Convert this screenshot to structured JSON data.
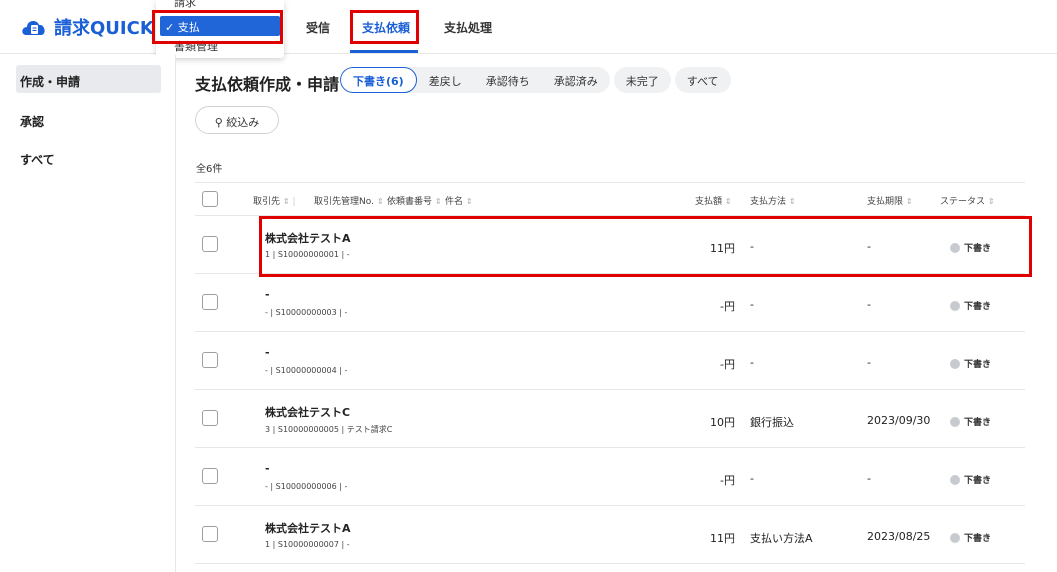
{
  "app": {
    "logo_text": "請求QUICK",
    "logo_alt": "QUICK"
  },
  "mode_menu": {
    "option_above": "請求",
    "selected": "✓ 支払",
    "option_below": "書類管理"
  },
  "nav_tabs": [
    {
      "label": "受信"
    },
    {
      "label": "支払依頼"
    },
    {
      "label": "支払処理"
    }
  ],
  "sidebar": {
    "items": [
      {
        "label": "作成・申請"
      },
      {
        "label": "承認"
      },
      {
        "label": "すべて"
      }
    ]
  },
  "page": {
    "title": "支払依頼作成・申請",
    "filter_button": "⚲ 絞込み",
    "count": "全6件"
  },
  "filter_tabs": {
    "group": [
      "下書き(6)",
      "差戻し",
      "承認待ち",
      "承認済み"
    ],
    "solo": [
      "未完了",
      "すべて"
    ]
  },
  "table": {
    "headers": {
      "vendor": "取引先",
      "vendor_no": "取引先管理No.",
      "doc_no": "依頼書番号",
      "subject": "件名",
      "amount": "支払額",
      "method": "支払方法",
      "due": "支払期限",
      "status": "ステータス"
    },
    "rows": [
      {
        "name": "株式会社テストA",
        "sub": "1 | S10000000001 | -",
        "amount": "11円",
        "method": "-",
        "due": "-",
        "status": "下書き"
      },
      {
        "name": "-",
        "sub": "- | S10000000003 | -",
        "amount": "-円",
        "method": "-",
        "due": "-",
        "status": "下書き"
      },
      {
        "name": "-",
        "sub": "- | S10000000004 | -",
        "amount": "-円",
        "method": "-",
        "due": "-",
        "status": "下書き"
      },
      {
        "name": "株式会社テストC",
        "sub": "3 | S10000000005 | テスト請求C",
        "amount": "10円",
        "method": "銀行振込",
        "due": "2023/09/30",
        "status": "下書き"
      },
      {
        "name": "-",
        "sub": "- | S10000000006 | -",
        "amount": "-円",
        "method": "-",
        "due": "-",
        "status": "下書き"
      },
      {
        "name": "株式会社テストA",
        "sub": "1 | S10000000007 | -",
        "amount": "11円",
        "method": "支払い方法A",
        "due": "2023/08/25",
        "status": "下書き"
      }
    ]
  },
  "colors": {
    "brand": "#1a5fd6",
    "highlight": "#e00000",
    "status_dot": "#c7cbd0"
  }
}
